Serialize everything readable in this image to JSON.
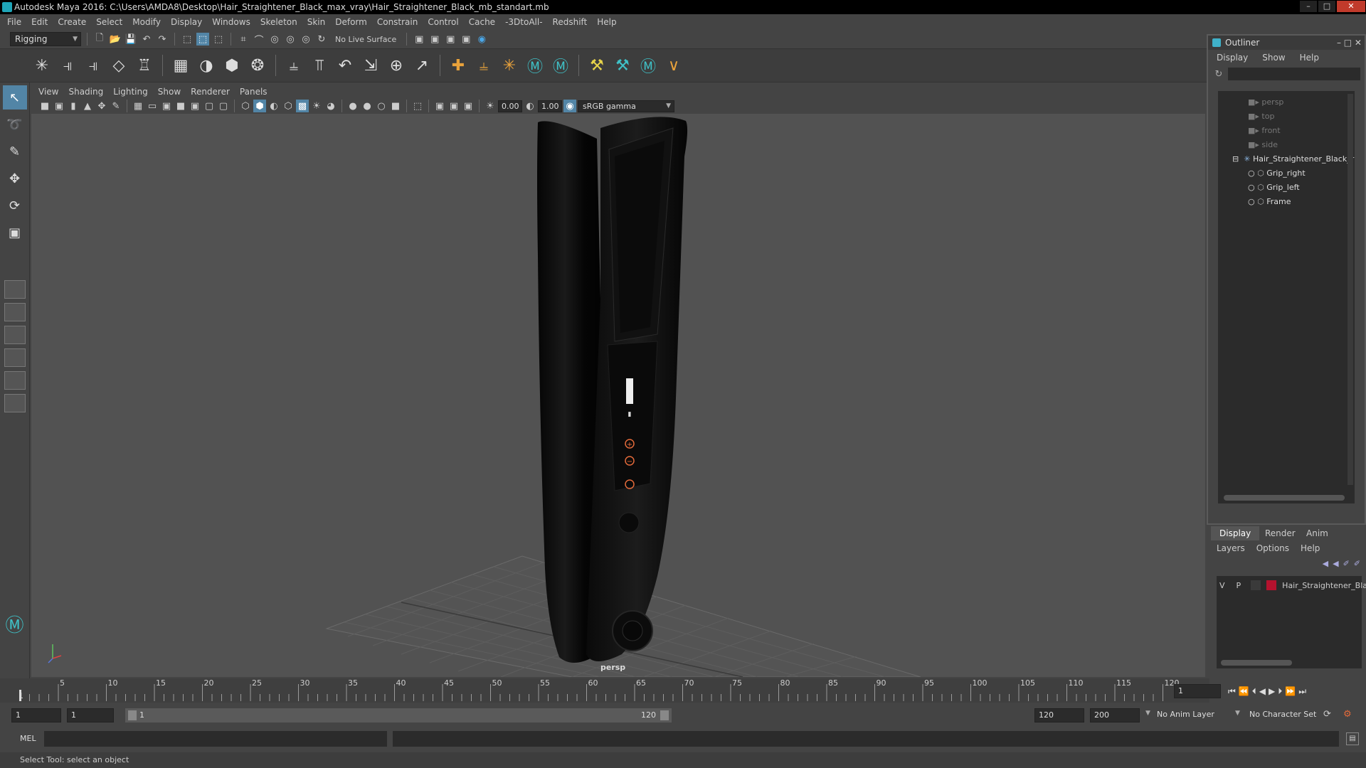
{
  "window": {
    "title": "Autodesk Maya 2016: C:\\Users\\AMDA8\\Desktop\\Hair_Straightener_Black_max_vray\\Hair_Straightener_Black_mb_standart.mb"
  },
  "menu": [
    "File",
    "Edit",
    "Create",
    "Select",
    "Modify",
    "Display",
    "Windows",
    "Skeleton",
    "Skin",
    "Deform",
    "Constrain",
    "Control",
    "Cache",
    "-3DtoAll-",
    "Redshift",
    "Help"
  ],
  "statusline": {
    "mode": "Rigging",
    "live_surface": "No Live Surface"
  },
  "panel": {
    "menu": [
      "View",
      "Shading",
      "Lighting",
      "Show",
      "Renderer",
      "Panels"
    ],
    "exposure": "0.00",
    "gamma": "1.00",
    "colorspace": "sRGB gamma",
    "camera": "persp"
  },
  "timeline": {
    "ticks": [
      "5",
      "10",
      "15",
      "20",
      "25",
      "30",
      "35",
      "40",
      "45",
      "50",
      "55",
      "60",
      "65",
      "70",
      "75",
      "80",
      "85",
      "90",
      "95",
      "100",
      "105",
      "110",
      "115",
      "120"
    ],
    "start_tick": "1",
    "current_frame": "1"
  },
  "range": {
    "start": "1",
    "playback_start": "1",
    "slider_start": "1",
    "slider_end": "120",
    "playback_end": "120",
    "end": "200",
    "anim_layer": "No Anim Layer",
    "char_set": "No Character Set"
  },
  "cmdline": {
    "lang": "MEL"
  },
  "helpline": {
    "text": "Select Tool: select an object"
  },
  "outliner": {
    "title": "Outliner",
    "menu": [
      "Display",
      "Show",
      "Help"
    ],
    "items": [
      {
        "label": "persp"
      },
      {
        "label": "top"
      },
      {
        "label": "front"
      },
      {
        "label": "side"
      },
      {
        "label": "Hair_Straightener_Black_r"
      },
      {
        "label": "Grip_right"
      },
      {
        "label": "Grip_left"
      },
      {
        "label": "Frame"
      }
    ]
  },
  "layers": {
    "tabs": [
      "Display",
      "Render",
      "Anim"
    ],
    "menu": [
      "Layers",
      "Options",
      "Help"
    ],
    "layer": {
      "v": "V",
      "p": "P",
      "name": "Hair_Straightener_Blac",
      "color": "#b5122e"
    }
  },
  "colors": {
    "accent": "#5285a6",
    "teal": "#3fc2c8"
  }
}
